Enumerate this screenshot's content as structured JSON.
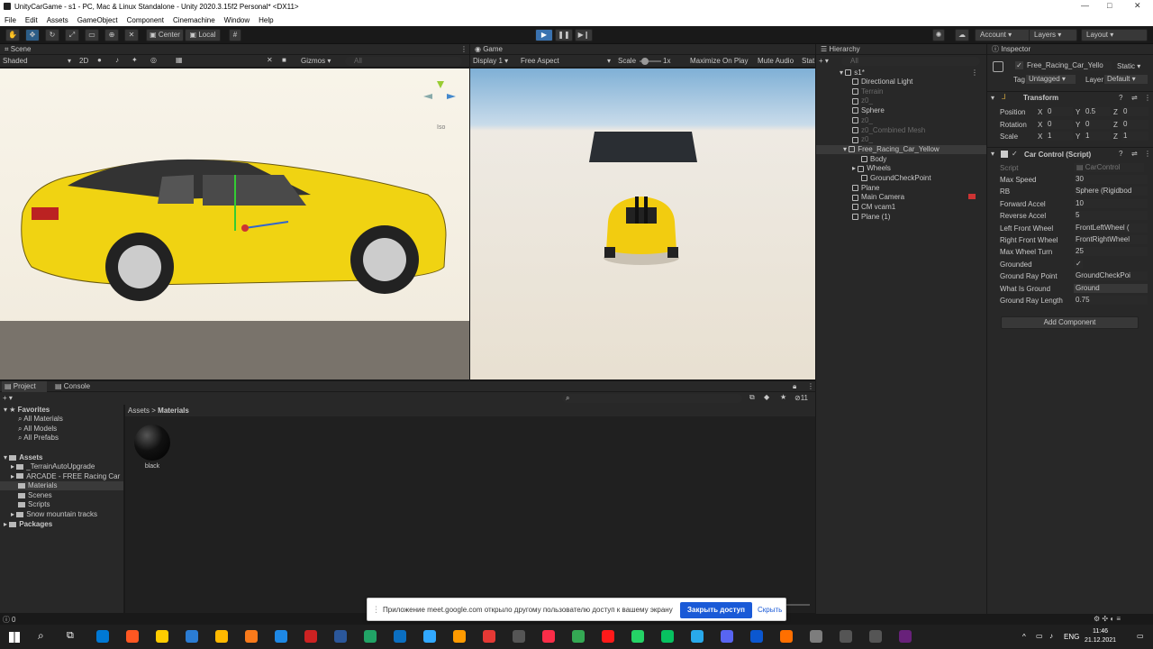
{
  "window": {
    "title": "UnityCarGame - s1 - PC, Mac & Linux Standalone - Unity 2020.3.15f2 Personal* <DX11>",
    "min": "—",
    "max": "□",
    "close": "✕"
  },
  "menu": [
    "File",
    "Edit",
    "Assets",
    "GameObject",
    "Component",
    "Cinemachine",
    "Window",
    "Help"
  ],
  "toolbar": {
    "center": "Center",
    "local": "Local",
    "account": "Account",
    "layers": "Layers",
    "layout": "Layout"
  },
  "scene": {
    "tab": "Scene",
    "shading": "Shaded",
    "mode2d": "2D",
    "gizmos": "Gizmos",
    "search": "All",
    "iso": "Iso"
  },
  "game": {
    "tab": "Game",
    "display": "Display 1",
    "aspect": "Free Aspect",
    "scale_label": "Scale",
    "scale_value": "1x",
    "maximize": "Maximize On Play",
    "mute": "Mute Audio",
    "stats": "Stat"
  },
  "hierarchy": {
    "tab": "Hierarchy",
    "search": "All",
    "scene": "s1*",
    "items": [
      {
        "label": "Directional Light",
        "dim": false,
        "indent": 0
      },
      {
        "label": "Terrain",
        "dim": true,
        "indent": 0
      },
      {
        "label": "z0_",
        "dim": true,
        "indent": 0
      },
      {
        "label": "Sphere",
        "dim": false,
        "indent": 0
      },
      {
        "label": "z0_",
        "dim": true,
        "indent": 0
      },
      {
        "label": "z0_Combined Mesh",
        "dim": true,
        "indent": 0
      },
      {
        "label": "z0_",
        "dim": true,
        "indent": 0
      },
      {
        "label": "Free_Racing_Car_Yellow",
        "dim": false,
        "indent": 0,
        "selected": true
      },
      {
        "label": "Body",
        "dim": false,
        "indent": 1
      },
      {
        "label": "Wheels",
        "dim": false,
        "indent": 1
      },
      {
        "label": "GroundCheckPoint",
        "dim": false,
        "indent": 1
      },
      {
        "label": "Plane",
        "dim": false,
        "indent": 0
      },
      {
        "label": "Main Camera",
        "dim": false,
        "indent": 0
      },
      {
        "label": "CM vcam1",
        "dim": false,
        "indent": 0
      },
      {
        "label": "Plane (1)",
        "dim": false,
        "indent": 0
      }
    ]
  },
  "inspector": {
    "tab": "Inspector",
    "object_name": "Free_Racing_Car_Yello",
    "static": "Static",
    "tag_label": "Tag",
    "tag_value": "Untagged",
    "layer_label": "Layer",
    "layer_value": "Default",
    "transform": {
      "title": "Transform",
      "rows": [
        {
          "label": "Position",
          "x": "0",
          "y": "0.5",
          "z": "0"
        },
        {
          "label": "Rotation",
          "x": "0",
          "y": "0",
          "z": "0"
        },
        {
          "label": "Scale",
          "x": "1",
          "y": "1",
          "z": "1"
        }
      ]
    },
    "script": {
      "title": "Car Control (Script)",
      "script_label": "Script",
      "script_value": "CarControl",
      "fields": [
        {
          "label": "Max Speed",
          "value": "30"
        },
        {
          "label": "RB",
          "value": "Sphere (Rigidbod"
        },
        {
          "label": "Forward Accel",
          "value": "10"
        },
        {
          "label": "Reverse Accel",
          "value": "5"
        },
        {
          "label": "Left Front Wheel",
          "value": "FrontLeftWheel ("
        },
        {
          "label": "Right Front Wheel",
          "value": "FrontRightWheel"
        },
        {
          "label": "Max Wheel Turn",
          "value": "25"
        },
        {
          "label": "Grounded",
          "value": "✓"
        },
        {
          "label": "Ground Ray Point",
          "value": "GroundCheckPoi"
        },
        {
          "label": "What Is Ground",
          "value": "Ground"
        },
        {
          "label": "Ground Ray Length",
          "value": "0.75"
        }
      ]
    },
    "add_component": "Add Component"
  },
  "project": {
    "tab_project": "Project",
    "tab_console": "Console",
    "breadcrumb_root": "Assets",
    "breadcrumb_sep": ">",
    "breadcrumb_current": "Materials",
    "count": "11",
    "favorites": "Favorites",
    "favorite_items": [
      "All Materials",
      "All Models",
      "All Prefabs"
    ],
    "assets": "Assets",
    "asset_folders": [
      "_TerrainAutoUpgrade",
      "ARCADE - FREE Racing Car",
      "Materials",
      "Scenes",
      "Scripts",
      "Snow mountain tracks"
    ],
    "packages": "Packages",
    "material_name": "black"
  },
  "notification": {
    "text": "Приложение meet.google.com открыло другому пользователю доступ к вашему экрану",
    "stop": "Закрыть доступ",
    "hide": "Скрыть"
  },
  "statusbar": {
    "count": "0"
  },
  "taskbar": {
    "lang": "ENG",
    "time": "11:46",
    "date": "21.12.2021",
    "colors": [
      "#0078d4",
      "#ff5722",
      "#ffcc00",
      "#2b7cd3",
      "#ffb900",
      "#f97a1b",
      "#1e88e5",
      "#cc2222",
      "#2b579a",
      "#21a366",
      "#0b6fc1",
      "#31a8ff",
      "#ff9a00",
      "#e53935",
      "#555555",
      "#fa2d48",
      "#34a853",
      "#ff1a1a",
      "#25d366",
      "#07c160",
      "#29a9eb",
      "#5865f2",
      "#0b57d0",
      "#ff6f00",
      "#7d7d7d",
      "#555555",
      "#555555",
      "#68217a"
    ]
  }
}
